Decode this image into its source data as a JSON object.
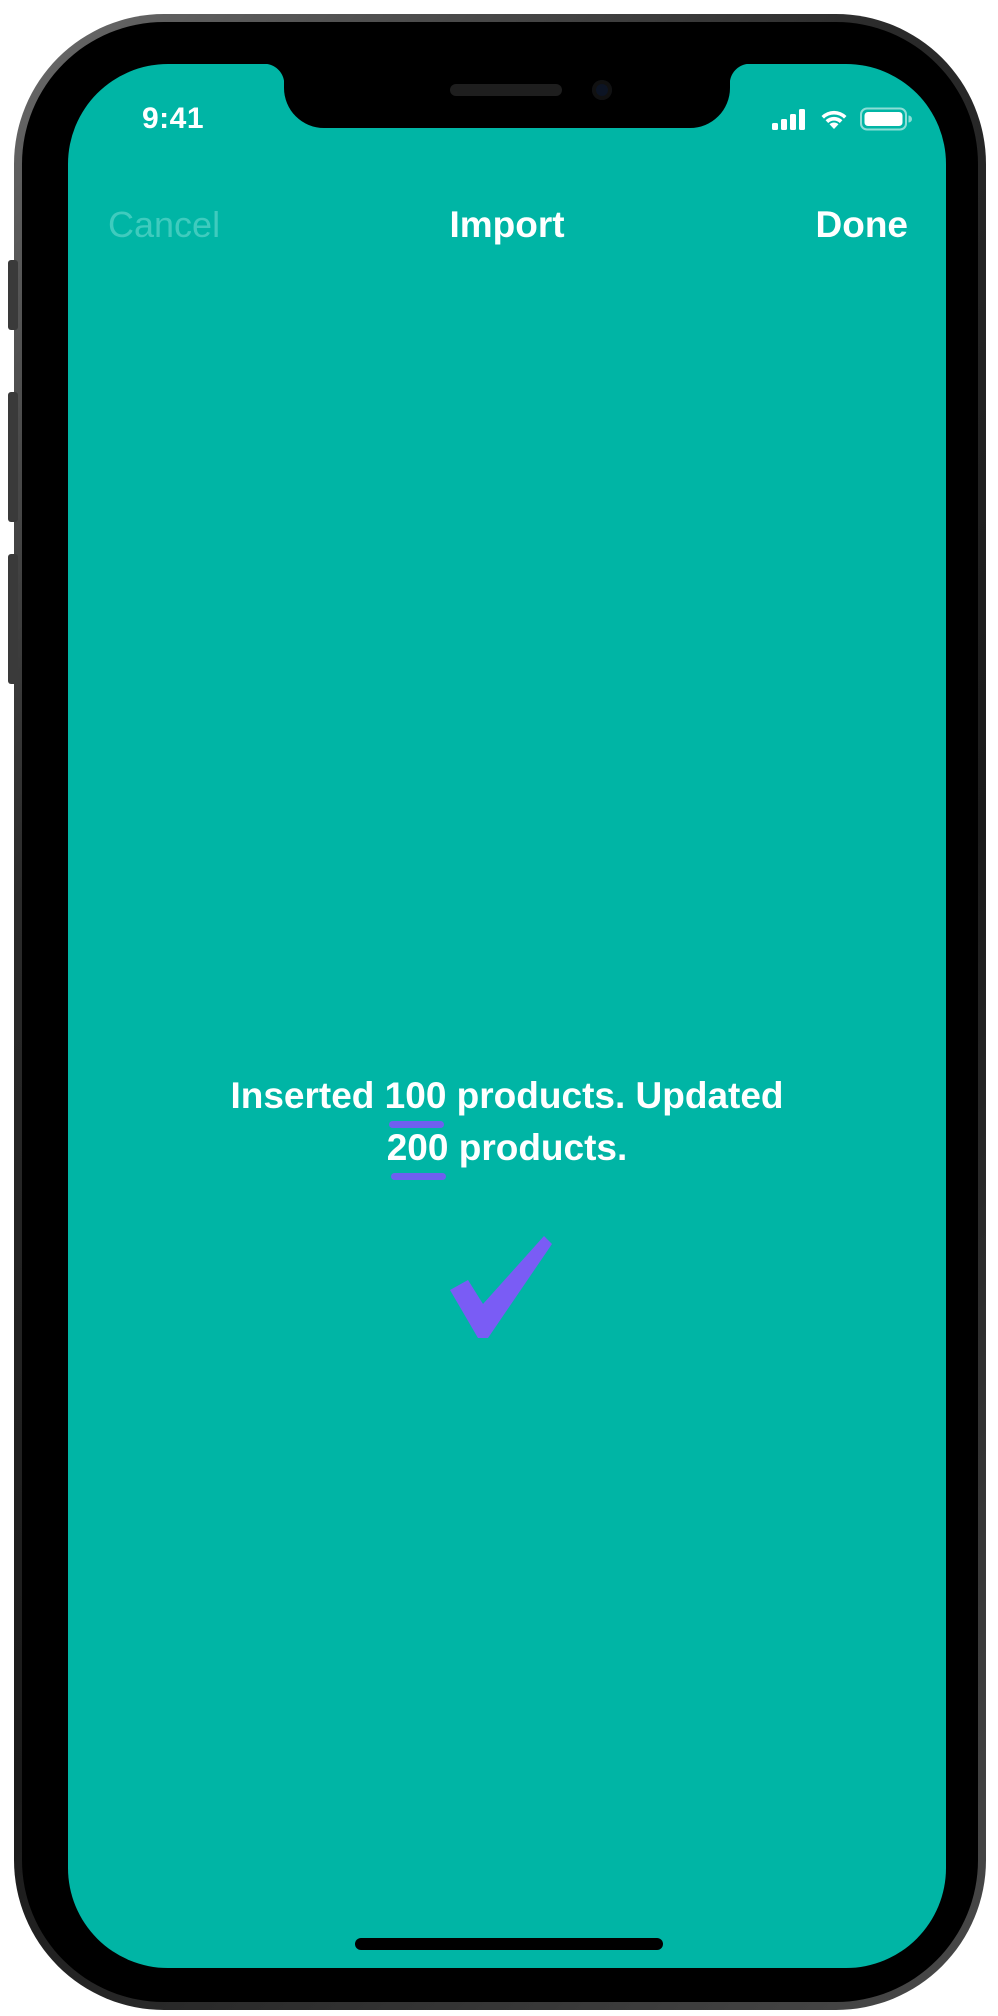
{
  "status_bar": {
    "time": "9:41",
    "icons": [
      "cellular-signal-icon",
      "wifi-icon",
      "battery-icon"
    ]
  },
  "navbar": {
    "cancel_label": "Cancel",
    "title": "Import",
    "done_label": "Done"
  },
  "result": {
    "prefix": "Inserted ",
    "inserted_count": "100",
    "middle": " products. Updated",
    "updated_count": "200",
    "suffix": " products."
  },
  "colors": {
    "background": "#00b5a5",
    "accent": "#6f5ff0",
    "disabled_text": "#3fcbbe"
  }
}
